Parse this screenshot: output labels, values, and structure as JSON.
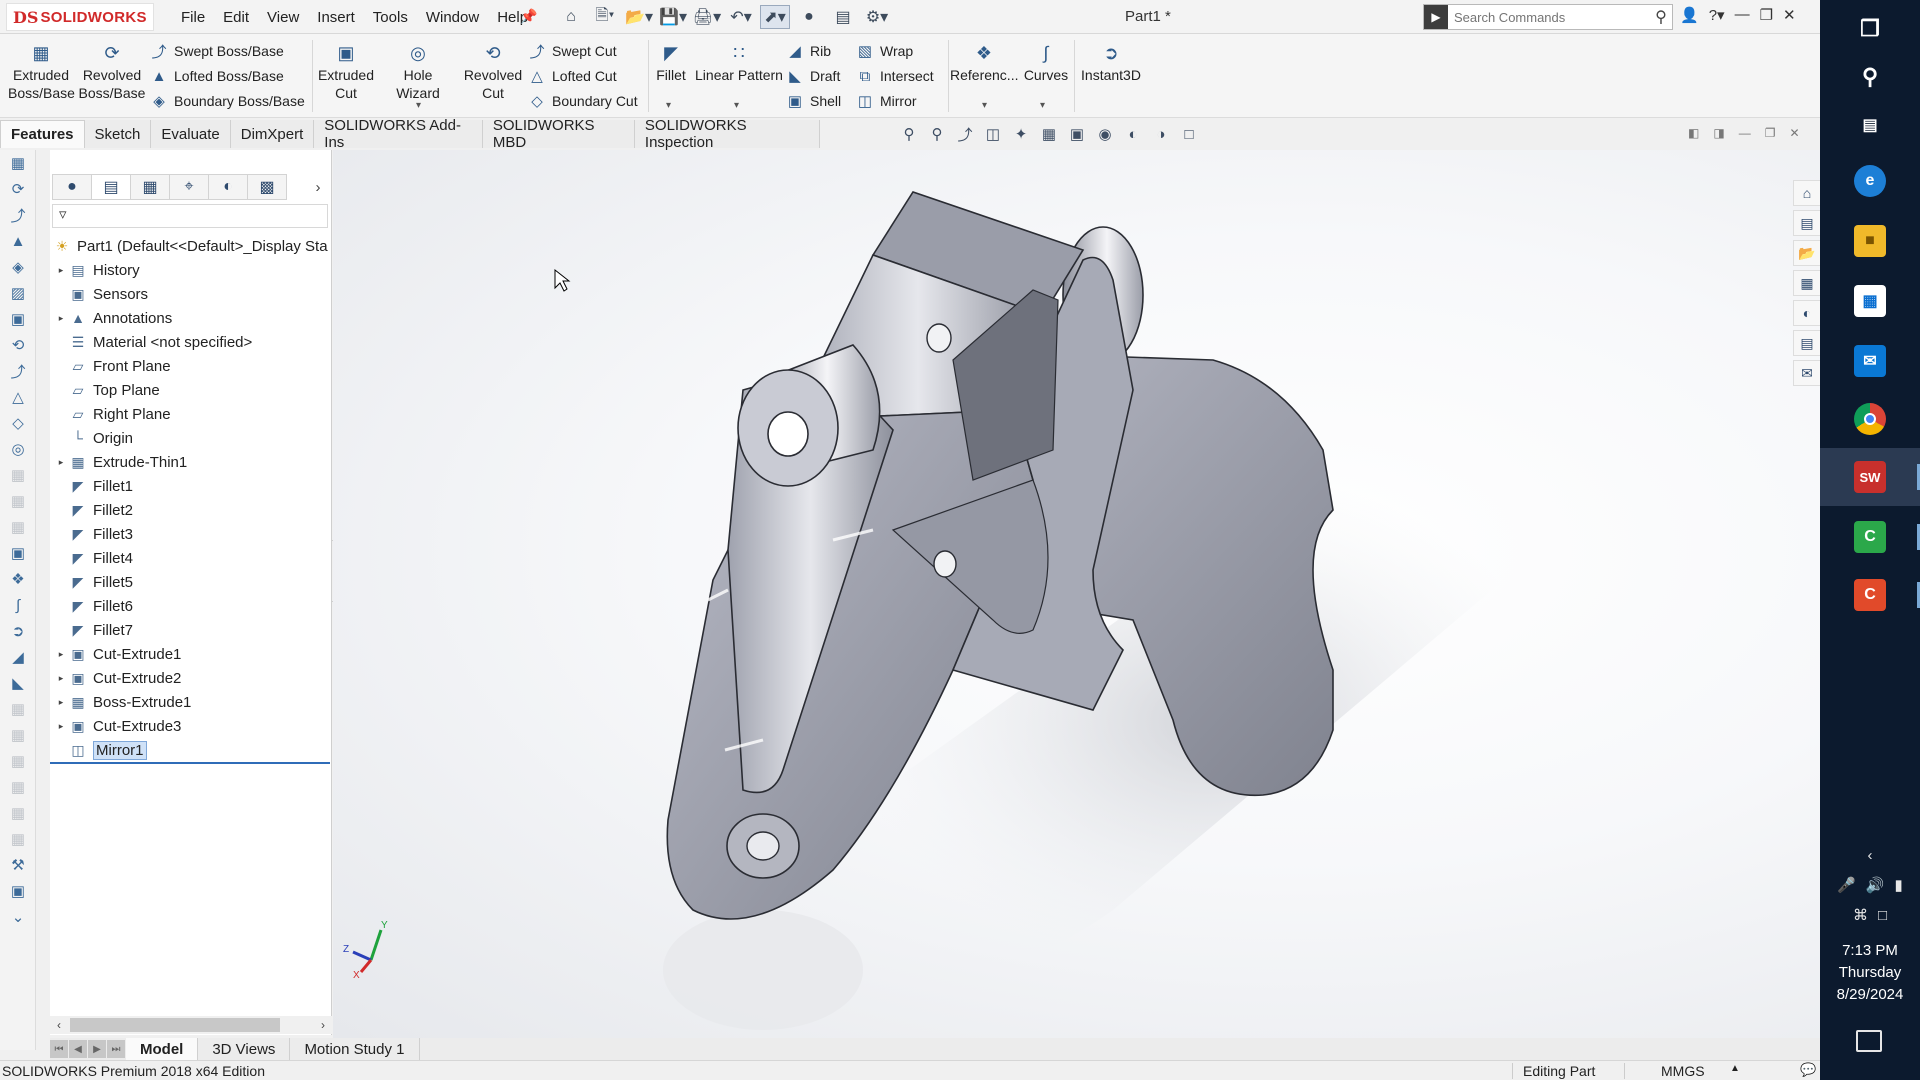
{
  "app": {
    "logo_ds": "DS",
    "logo_text": "SOLIDWORKS",
    "menu": [
      "File",
      "Edit",
      "View",
      "Insert",
      "Tools",
      "Window",
      "Help"
    ],
    "doc_title": "Part1 *",
    "search_placeholder": "Search Commands"
  },
  "ribbon": {
    "extruded_boss": [
      "Extruded",
      "Boss/Base"
    ],
    "revolved_boss": [
      "Revolved",
      "Boss/Base"
    ],
    "swept_boss": "Swept Boss/Base",
    "lofted_boss": "Lofted Boss/Base",
    "boundary_boss": "Boundary Boss/Base",
    "extruded_cut": [
      "Extruded",
      "Cut"
    ],
    "hole_wizard": "Hole Wizard",
    "revolved_cut": [
      "Revolved",
      "Cut"
    ],
    "swept_cut": "Swept Cut",
    "lofted_cut": "Lofted Cut",
    "boundary_cut": "Boundary Cut",
    "fillet": "Fillet",
    "linear_pattern": "Linear Pattern",
    "rib": "Rib",
    "draft": "Draft",
    "shell": "Shell",
    "wrap": "Wrap",
    "intersect": "Intersect",
    "mirror": "Mirror",
    "reference": "Referenc...",
    "curves": "Curves",
    "instant3d": "Instant3D"
  },
  "command_tabs": [
    "Features",
    "Sketch",
    "Evaluate",
    "DimXpert",
    "SOLIDWORKS Add-Ins",
    "SOLIDWORKS MBD",
    "SOLIDWORKS Inspection"
  ],
  "feature_tree": {
    "root": "Part1  (Default<<Default>_Display Sta",
    "items": [
      {
        "label": "History",
        "expand": true,
        "icon": "history-folder-icon"
      },
      {
        "label": "Sensors",
        "expand": false,
        "icon": "sensors-icon"
      },
      {
        "label": "Annotations",
        "expand": true,
        "icon": "annotations-icon"
      },
      {
        "label": "Material <not specified>",
        "expand": false,
        "icon": "material-icon"
      },
      {
        "label": "Front Plane",
        "expand": false,
        "icon": "plane-icon"
      },
      {
        "label": "Top Plane",
        "expand": false,
        "icon": "plane-icon"
      },
      {
        "label": "Right Plane",
        "expand": false,
        "icon": "plane-icon"
      },
      {
        "label": "Origin",
        "expand": false,
        "icon": "origin-icon"
      },
      {
        "label": "Extrude-Thin1",
        "expand": true,
        "icon": "extrude-icon"
      },
      {
        "label": "Fillet1",
        "expand": false,
        "icon": "fillet-icon"
      },
      {
        "label": "Fillet2",
        "expand": false,
        "icon": "fillet-icon"
      },
      {
        "label": "Fillet3",
        "expand": false,
        "icon": "fillet-icon"
      },
      {
        "label": "Fillet4",
        "expand": false,
        "icon": "fillet-icon"
      },
      {
        "label": "Fillet5",
        "expand": false,
        "icon": "fillet-icon"
      },
      {
        "label": "Fillet6",
        "expand": false,
        "icon": "fillet-icon"
      },
      {
        "label": "Fillet7",
        "expand": false,
        "icon": "fillet-icon"
      },
      {
        "label": "Cut-Extrude1",
        "expand": true,
        "icon": "cut-extrude-icon"
      },
      {
        "label": "Cut-Extrude2",
        "expand": true,
        "icon": "cut-extrude-icon"
      },
      {
        "label": "Boss-Extrude1",
        "expand": true,
        "icon": "extrude-icon"
      },
      {
        "label": "Cut-Extrude3",
        "expand": true,
        "icon": "cut-extrude-icon"
      },
      {
        "label": "Mirror1",
        "expand": false,
        "icon": "mirror-icon",
        "selected": true
      }
    ]
  },
  "bottom_tabs": [
    "Model",
    "3D Views",
    "Motion Study 1"
  ],
  "status": {
    "edition": "SOLIDWORKS Premium 2018 x64 Edition",
    "mode": "Editing Part",
    "units": "MMGS"
  },
  "triad": {
    "y": "Y",
    "z": "Z",
    "x": "X"
  },
  "taskbar": {
    "time": "7:13 PM",
    "day": "Thursday",
    "date": "8/29/2024"
  }
}
